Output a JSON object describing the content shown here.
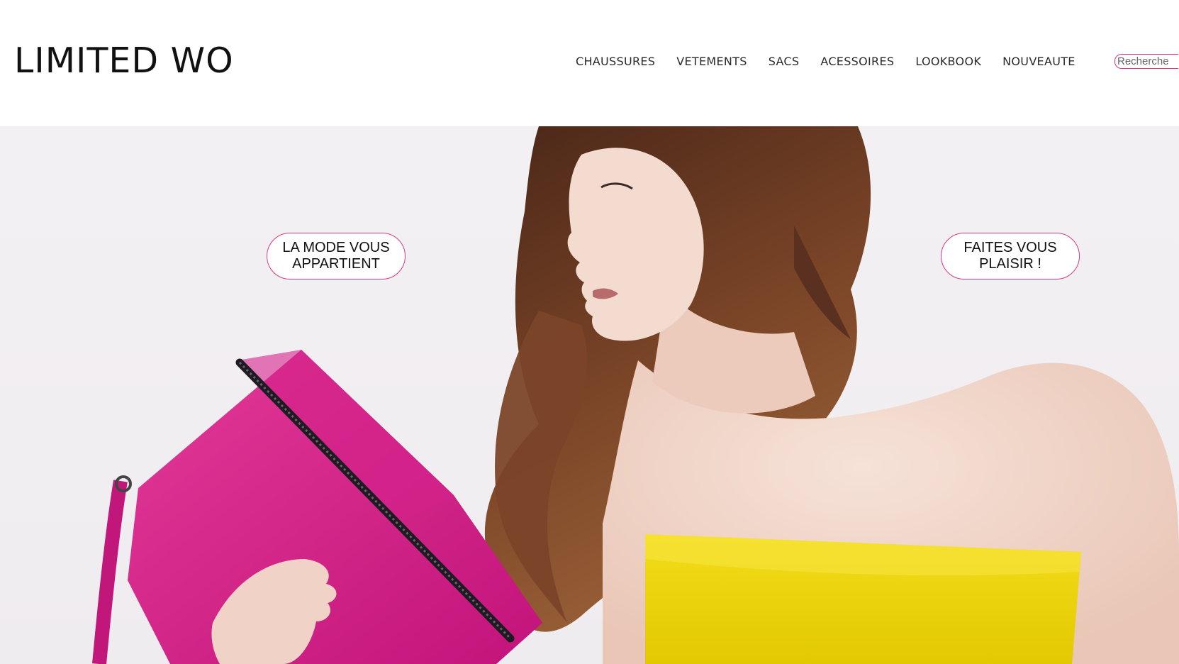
{
  "brand": {
    "logo_text": "LIMITED WO"
  },
  "nav": {
    "items": [
      {
        "label": "CHAUSSURES"
      },
      {
        "label": "VETEMENTS"
      },
      {
        "label": "SACS"
      },
      {
        "label": "ACESSOIRES"
      },
      {
        "label": "LOOKBOOK"
      },
      {
        "label": "NOUVEAUTE"
      }
    ]
  },
  "search": {
    "placeholder": "Recherche"
  },
  "hero": {
    "bubble_left": "LA MODE VOUS APPARTIENT",
    "bubble_right": "FAITES VOUS PLAISIR !"
  },
  "colors": {
    "accent": "#d6317f",
    "pink_bag": "#d61c84",
    "yellow_bag": "#ecd60a",
    "hair": "#6b3a22",
    "skin": "#f2d6c9"
  }
}
